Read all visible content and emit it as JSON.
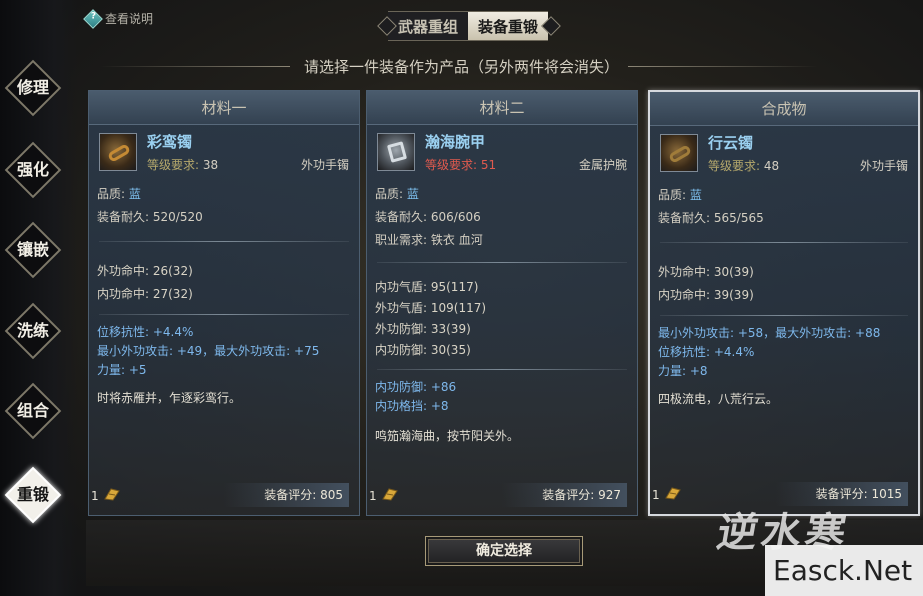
{
  "help": {
    "label": "查看说明"
  },
  "tabs": [
    {
      "label": "武器重组",
      "active": false
    },
    {
      "label": "装备重锻",
      "active": true
    }
  ],
  "subtitle": "请选择一件装备作为产品（另外两件将会消失）",
  "side_nav": [
    {
      "label": "修理",
      "active": false
    },
    {
      "label": "强化",
      "active": false
    },
    {
      "label": "镶嵌",
      "active": false
    },
    {
      "label": "洗练",
      "active": false
    },
    {
      "label": "组合",
      "active": false
    },
    {
      "label": "重锻",
      "active": true
    }
  ],
  "panels": [
    {
      "header": "材料一",
      "item_name": "彩鸾镯",
      "level_label": "等级要求:",
      "level_value": "38",
      "level_warn": false,
      "item_type": "外功手镯",
      "quality_label": "品质:",
      "quality_value": "蓝",
      "durability_label": "装备耐久:",
      "durability_value": "520/520",
      "stats_a": [
        "外功命中: 26(32)",
        "内功命中: 27(32)"
      ],
      "stats_b": [
        "位移抗性: +4.4%",
        "最小外功攻击: +49，最大外功攻击: +75",
        "力量: +5"
      ],
      "flavor": "时将赤雁并，乍逐彩鸾行。",
      "count": "1",
      "score_label": "装备评分:",
      "score_value": "805"
    },
    {
      "header": "材料二",
      "item_name": "瀚海腕甲",
      "level_label": "等级要求:",
      "level_value": "51",
      "level_warn": true,
      "item_type": "金属护腕",
      "quality_label": "品质:",
      "quality_value": "蓝",
      "durability_label": "装备耐久:",
      "durability_value": "606/606",
      "job_label": "职业需求:",
      "job_value": "铁衣 血河",
      "stats_a": [
        "内功气盾: 95(117)",
        "外功气盾: 109(117)",
        "外功防御: 33(39)",
        "内功防御: 30(35)"
      ],
      "stats_b": [
        "内功防御: +86",
        "内功格挡: +8"
      ],
      "flavor": "鸣笳瀚海曲，按节阳关外。",
      "count": "1",
      "score_label": "装备评分:",
      "score_value": "927"
    },
    {
      "header": "合成物",
      "item_name": "行云镯",
      "level_label": "等级要求:",
      "level_value": "48",
      "level_warn": false,
      "item_type": "外功手镯",
      "quality_label": "品质:",
      "quality_value": "蓝",
      "durability_label": "装备耐久:",
      "durability_value": "565/565",
      "stats_a": [
        "外功命中: 30(39)",
        "内功命中: 39(39)"
      ],
      "stats_b": [
        "最小外功攻击: +58，最大外功攻击: +88",
        "位移抗性: +4.4%",
        "力量: +8"
      ],
      "flavor": "四极流电，八荒行云。",
      "count": "1",
      "score_label": "装备评分:",
      "score_value": "1015"
    }
  ],
  "confirm_label": "确定选择",
  "watermark": "Easck.Net",
  "logo_text": "逆水寒",
  "colors": {
    "quality_blue": "#7ec0ef",
    "warn_red": "#e05a4e",
    "item_name": "#9ad0f0"
  }
}
